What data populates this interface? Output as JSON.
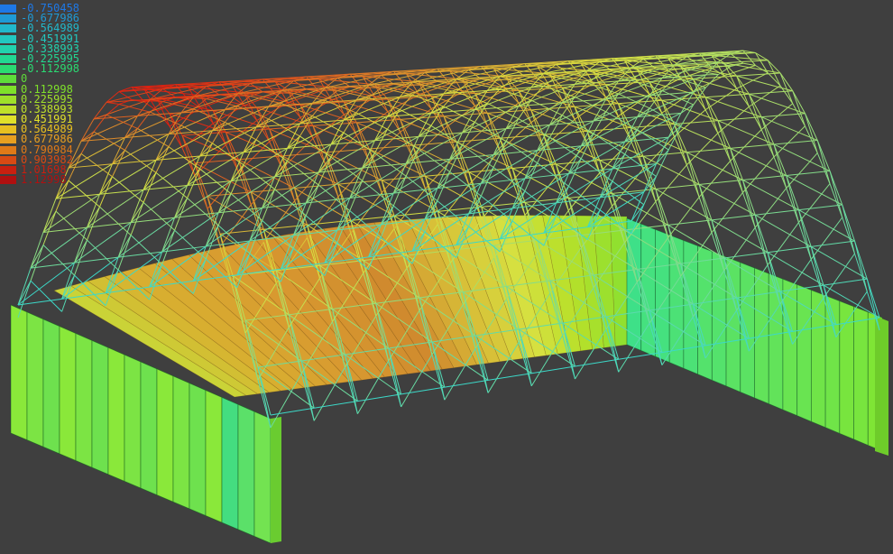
{
  "legend": {
    "entries": [
      {
        "label": "-0.750458",
        "color": "#1e78e6"
      },
      {
        "label": "-0.677986",
        "color": "#1f9ad6"
      },
      {
        "label": "-0.564989",
        "color": "#21b8cc"
      },
      {
        "label": "-0.451991",
        "color": "#22c8c0"
      },
      {
        "label": "-0.338993",
        "color": "#22d2ad"
      },
      {
        "label": "-0.225995",
        "color": "#22d892"
      },
      {
        "label": "-0.112998",
        "color": "#2adb72"
      },
      {
        "label": "0",
        "color": "#5edc3a"
      },
      {
        "label": "0.112998",
        "color": "#7ee02a"
      },
      {
        "label": "0.225995",
        "color": "#9fe02a"
      },
      {
        "label": "0.338993",
        "color": "#bfe02a"
      },
      {
        "label": "0.451991",
        "color": "#e0e02a"
      },
      {
        "label": "0.564989",
        "color": "#e8c020"
      },
      {
        "label": "0.677986",
        "color": "#e8a020"
      },
      {
        "label": "0.790984",
        "color": "#e07a18"
      },
      {
        "label": "0.903982",
        "color": "#d84a14"
      },
      {
        "label": "1.01698",
        "color": "#c82010"
      },
      {
        "label": "1.12998",
        "color": "#b01010"
      }
    ]
  },
  "colors": {
    "background": "#3f3f3f",
    "wall_front": "#7ee83a",
    "wall_right": "#44e07a",
    "wall_back_hot": "#d8a030",
    "truss_cool": "#3cd8c8",
    "truss_mid": "#d8e040",
    "truss_hot": "#e02010"
  },
  "icons": [
    "truss-structure-icon"
  ]
}
